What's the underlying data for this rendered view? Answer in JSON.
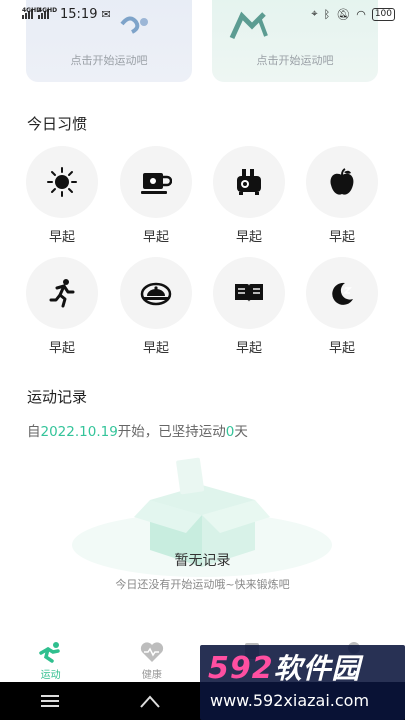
{
  "status_bar": {
    "network1": "4GHD",
    "network2": "4GHD",
    "time": "15:19",
    "battery": "100"
  },
  "top_cards": [
    {
      "text": "点击开始运动吧"
    },
    {
      "text": "点击开始运动吧"
    }
  ],
  "habits_section": {
    "title": "今日习惯",
    "items": [
      {
        "icon": "sun-icon",
        "label": "早起"
      },
      {
        "icon": "coffee-cup-icon",
        "label": "早起"
      },
      {
        "icon": "toaster-icon",
        "label": "早起"
      },
      {
        "icon": "apple-icon",
        "label": "早起"
      },
      {
        "icon": "running-person-icon",
        "label": "早起"
      },
      {
        "icon": "food-dish-icon",
        "label": "早起"
      },
      {
        "icon": "open-book-icon",
        "label": "早起"
      },
      {
        "icon": "moon-sleep-icon",
        "label": "早起"
      }
    ]
  },
  "records_section": {
    "title": "运动记录",
    "since_prefix": "自",
    "since_date": "2022.10.19",
    "since_middle": "开始，已坚持运动",
    "days": "0",
    "since_suffix": "天",
    "empty_title": "暂无记录",
    "empty_desc": "今日还没有开始运动哦~快来锻炼吧"
  },
  "tab_bar": {
    "tabs": [
      {
        "label": "运动",
        "icon": "runner-icon",
        "active": true
      },
      {
        "label": "健康",
        "icon": "heart-pulse-icon",
        "active": false
      },
      {
        "label": "",
        "icon": "cup-icon",
        "active": false
      },
      {
        "label": "",
        "icon": "person-icon",
        "active": false
      }
    ]
  },
  "watermark": {
    "brand_number": "592",
    "brand_text": "软件园",
    "url": "www.592xiazai.com"
  },
  "colors": {
    "accent": "#34c49a",
    "tab_active": "#2fbf8e",
    "circle_bg": "#f4f4f4"
  }
}
